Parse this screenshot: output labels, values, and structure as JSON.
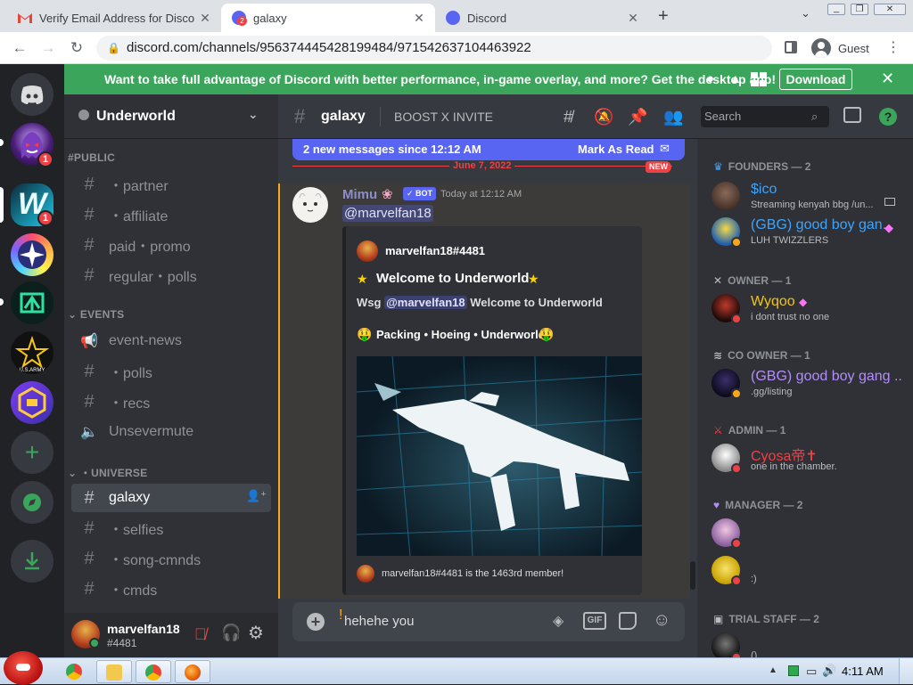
{
  "browser": {
    "tabs": [
      {
        "title": "Verify Email Address for Disco"
      },
      {
        "title": "galaxy",
        "badge": "2"
      },
      {
        "title": "Discord"
      }
    ],
    "url": "discord.com/channels/956374445428199484/971542637104463922",
    "profile_label": "Guest"
  },
  "banner": {
    "text": "Want to take full advantage of Discord with better performance, in-game overlay, and more? Get the desktop app!",
    "download_label": "Download"
  },
  "servers": [
    {
      "name": "Discord Home",
      "icon": "discord-logo-icon"
    },
    {
      "name": "ghost server",
      "badge": "1"
    },
    {
      "name": "W server",
      "badge": "1"
    },
    {
      "name": "star server"
    },
    {
      "name": "green server"
    },
    {
      "name": "US Army server"
    },
    {
      "name": "Underworld"
    }
  ],
  "guild": {
    "name": "Underworld"
  },
  "categories": {
    "public": "#PUBLIC",
    "events": "EVENTS",
    "universe": "・UNIVERSE"
  },
  "channels": {
    "public": [
      {
        "label": "・partner"
      },
      {
        "label": "・affiliate"
      },
      {
        "label": "paid・promo"
      },
      {
        "label": "regular・polls"
      }
    ],
    "events": [
      {
        "label": "event-news",
        "icon": "megaphone-icon"
      },
      {
        "label": "・polls"
      },
      {
        "label": "・recs"
      },
      {
        "label": "Unsevermute",
        "icon": "speaker-icon"
      }
    ],
    "universe": [
      {
        "label": "galaxy",
        "selected": true
      },
      {
        "label": "・selfies"
      },
      {
        "label": "・song-cmnds"
      },
      {
        "label": "・cmds"
      }
    ]
  },
  "user_panel": {
    "username": "marvelfan18",
    "tag": "#4481"
  },
  "chat_header": {
    "channel": "galaxy",
    "topic": "BOOST X INVITE"
  },
  "new_messages": {
    "text": "2 new messages since 12:12 AM",
    "action": "Mark As Read"
  },
  "date_divider": {
    "date": "June 7, 2022",
    "new_label": "NEW"
  },
  "message": {
    "author": "Mimu",
    "bot_label": "BOT",
    "time": "Today at 12:12 AM",
    "mention": "@marvelfan18",
    "embed": {
      "author": "marvelfan18#4481",
      "title": "Welcome to Underworld",
      "body_prefix": "Wsg",
      "body_mention": "@marvelfan18",
      "body_suffix": "Welcome to Underworld",
      "subtitle": "Packing • Hoeing • Underworld",
      "footer": "marvelfan18#4481 is the 1463rd member!"
    }
  },
  "composer": {
    "value": "hehehe you"
  },
  "search": {
    "placeholder": "Search"
  },
  "members": {
    "groups": [
      {
        "title": "FOUNDERS — 2",
        "members": [
          {
            "name": "$ico",
            "status": "Streaming kenyah bbg /un...",
            "color": "#3ba5ff"
          },
          {
            "name": "(GBG) good boy gan...",
            "status": "LUH TWIZZLERS",
            "color": "#3ba5ff"
          }
        ]
      },
      {
        "title": "OWNER — 1",
        "members": [
          {
            "name": "Wyqoo",
            "status": "i dont trust no one",
            "color": "#f0c419"
          }
        ]
      },
      {
        "title": "CO OWNER — 1",
        "members": [
          {
            "name": "(GBG) good boy gang ...",
            "status": ".gg/listing",
            "color": "#b48cff"
          }
        ]
      },
      {
        "title": "ADMIN — 1",
        "members": [
          {
            "name": "Cyosa帝✝",
            "status": "one in the chamber.",
            "color": "#ed4245"
          }
        ]
      },
      {
        "title": "MANAGER — 2",
        "members": [
          {
            "name": "",
            "status": "",
            "color": "#9b2f9b"
          },
          {
            "name": "",
            "status": ":)",
            "color": "#9b2f9b"
          }
        ]
      },
      {
        "title": "TRIAL STAFF — 2",
        "members": [
          {
            "name": "",
            "status": "()",
            "color": "#dcddde"
          }
        ]
      }
    ]
  },
  "taskbar": {
    "time": "4:11 AM"
  }
}
